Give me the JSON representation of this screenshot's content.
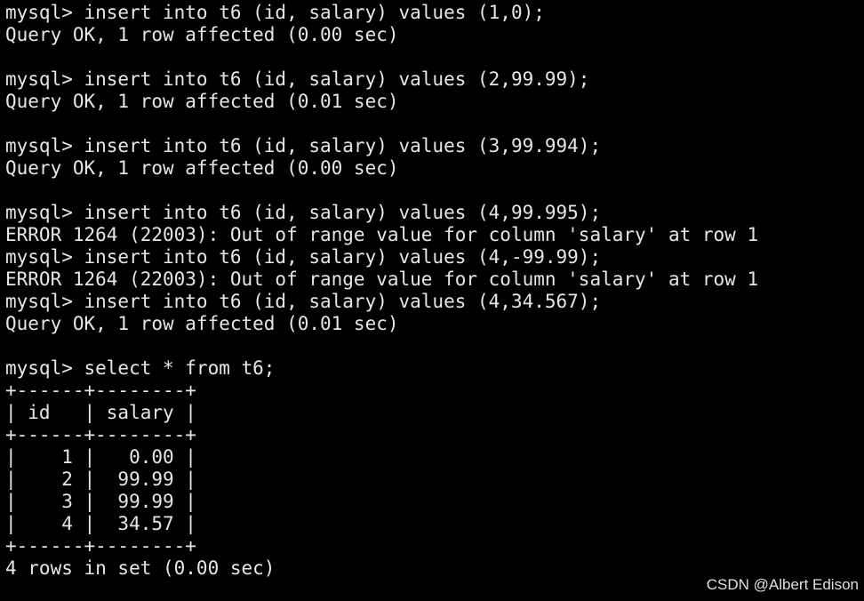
{
  "terminal": {
    "lines": [
      "mysql> insert into t6 (id, salary) values (1,0);",
      "Query OK, 1 row affected (0.00 sec)",
      "",
      "mysql> insert into t6 (id, salary) values (2,99.99);",
      "Query OK, 1 row affected (0.01 sec)",
      "",
      "mysql> insert into t6 (id, salary) values (3,99.994);",
      "Query OK, 1 row affected (0.00 sec)",
      "",
      "mysql> insert into t6 (id, salary) values (4,99.995);",
      "ERROR 1264 (22003): Out of range value for column 'salary' at row 1",
      "mysql> insert into t6 (id, salary) values (4,-99.99);",
      "ERROR 1264 (22003): Out of range value for column 'salary' at row 1",
      "mysql> insert into t6 (id, salary) values (4,34.567);",
      "Query OK, 1 row affected (0.01 sec)",
      "",
      "mysql> select * from t6;",
      "+------+--------+",
      "| id   | salary |",
      "+------+--------+",
      "|    1 |   0.00 |",
      "|    2 |  99.99 |",
      "|    3 |  99.99 |",
      "|    4 |  34.57 |",
      "+------+--------+",
      "4 rows in set (0.00 sec)"
    ]
  },
  "watermark": "CSDN @Albert Edison"
}
